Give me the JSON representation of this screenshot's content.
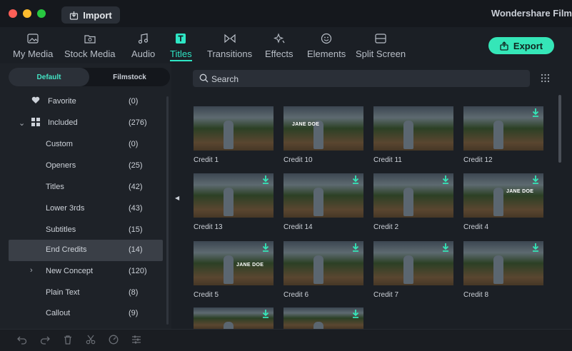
{
  "titlebar": {
    "import_label": "Import",
    "app_title": "Wondershare Film"
  },
  "tabs": [
    {
      "label": "My Media",
      "icon": "image-icon"
    },
    {
      "label": "Stock Media",
      "icon": "stock-folder-icon"
    },
    {
      "label": "Audio",
      "icon": "music-note-icon"
    },
    {
      "label": "Titles",
      "icon": "text-t-icon",
      "active": true
    },
    {
      "label": "Transitions",
      "icon": "transition-icon"
    },
    {
      "label": "Effects",
      "icon": "sparkle-icon"
    },
    {
      "label": "Elements",
      "icon": "smiley-icon"
    },
    {
      "label": "Split Screen",
      "icon": "split-screen-icon"
    }
  ],
  "export_label": "Export",
  "sidebar": {
    "tabs": [
      {
        "label": "Default",
        "active": true
      },
      {
        "label": "Filmstock",
        "active": false
      }
    ],
    "categories": [
      {
        "name": "Favorite",
        "count": "(0)",
        "icon": "heart-icon"
      },
      {
        "name": "Included",
        "count": "(276)",
        "icon": "grid-icon",
        "expanded": true
      },
      {
        "name": "Custom",
        "count": "(0)"
      },
      {
        "name": "Openers",
        "count": "(25)"
      },
      {
        "name": "Titles",
        "count": "(42)"
      },
      {
        "name": "Lower 3rds",
        "count": "(43)"
      },
      {
        "name": "Subtitles",
        "count": "(15)"
      },
      {
        "name": "End Credits",
        "count": "(14)",
        "selected": true
      },
      {
        "name": "New Concept",
        "count": "(120)",
        "collapsed": true
      },
      {
        "name": "Plain Text",
        "count": "(8)"
      },
      {
        "name": "Callout",
        "count": "(9)"
      }
    ]
  },
  "search": {
    "placeholder": "Search"
  },
  "cards": [
    {
      "label": "Credit 1"
    },
    {
      "label": "Credit 10",
      "overlay": "JANE DOE"
    },
    {
      "label": "Credit 11"
    },
    {
      "label": "Credit 12"
    },
    {
      "label": "Credit 13"
    },
    {
      "label": "Credit 14"
    },
    {
      "label": "Credit 2"
    },
    {
      "label": "Credit 4",
      "overlay": "JANE DOE"
    },
    {
      "label": "Credit 5",
      "overlay": "JANE DOE"
    },
    {
      "label": "Credit 6"
    },
    {
      "label": "Credit 7"
    },
    {
      "label": "Credit 8"
    },
    {
      "label": ""
    },
    {
      "label": ""
    }
  ],
  "bottom_icons": [
    "undo-icon",
    "redo-icon",
    "trash-icon",
    "scissors-icon",
    "speed-icon",
    "adjust-icon"
  ],
  "colors": {
    "accent": "#2ee6c5",
    "export": "#35e6b8",
    "background": "#1b1f25"
  }
}
